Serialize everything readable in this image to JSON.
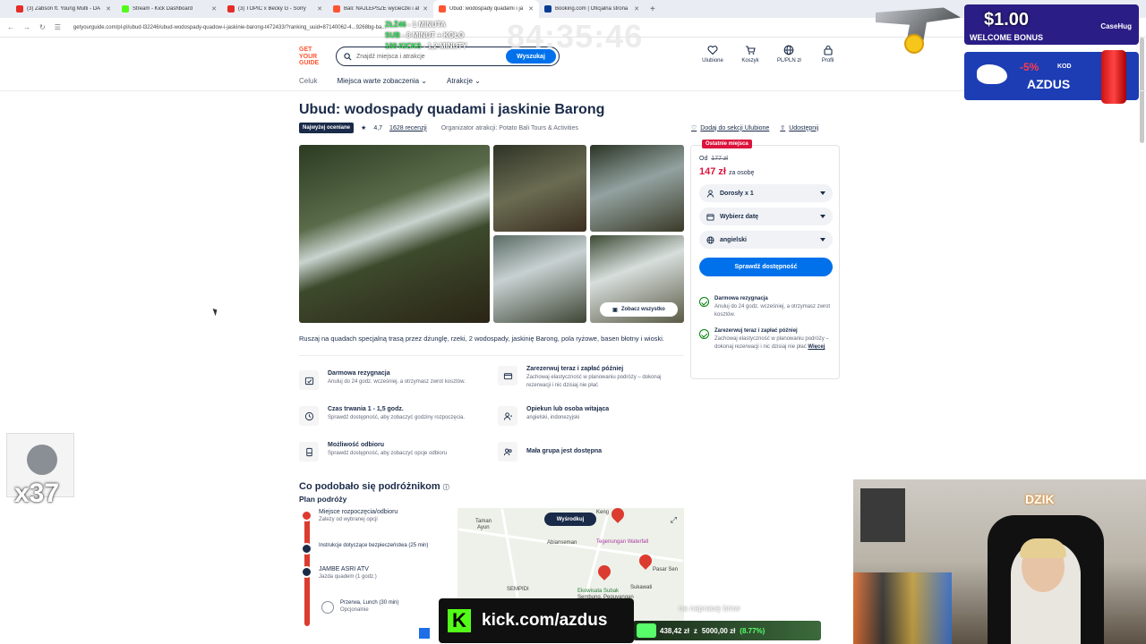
{
  "browser": {
    "tabs": [
      {
        "title": "(3) Zabson ft. Young Multi - DA",
        "color": "#e52d27"
      },
      {
        "title": "Stream - Kick Dashboard",
        "color": "#53fc18"
      },
      {
        "title": "(3) TOPIC x Becky G - Sorry",
        "color": "#e52d27"
      },
      {
        "title": "Bali: NAJLEPSZE wycieczki i atr",
        "color": "#ff5533"
      },
      {
        "title": "Ubud: wodospady quadami i ja",
        "color": "#ff5533"
      },
      {
        "title": "Booking.com | Oficjalna strona",
        "color": "#0a3c92"
      }
    ],
    "url": "getyourguide.com/pl-pl/ubud-l32246/ubud-wodospady-quadow-i-jaskinie-barong-t472433/?ranking_uuid=87140062-4...9268bg-ba..."
  },
  "header": {
    "logo": [
      "GET",
      "YOUR",
      "GUIDE"
    ],
    "search_placeholder": "Znajdź miejsca i atrakcje",
    "search_button": "Wyszukaj",
    "icons": [
      {
        "icon": "heart-icon",
        "label": "Ulubione"
      },
      {
        "icon": "cart-icon",
        "label": "Koszyk"
      },
      {
        "icon": "globe-icon",
        "label": "PL/PLN zł"
      },
      {
        "icon": "profile-icon",
        "label": "Profil"
      }
    ]
  },
  "subnav": [
    "Celuk",
    "Miejsca warte zobaczenia",
    "Atrakcje"
  ],
  "listing": {
    "title": "Ubud: wodospady quadami i jaskinie Barong",
    "badge": "Najwyżej oceniane",
    "rating": "4,7",
    "reviews": "1628 recenzji",
    "organizer": "Organizator atrakcji: Potato Bali Tours & Activities",
    "wishlist": "Dodaj do sekcji Ulubione",
    "share": "Udostępnij",
    "see_all": "Zobacz wszystko",
    "description": "Ruszaj na quadach specjalną trasą przez dżunglę, rzeki, 2 wodospady, jaskinię Barong, pola ryżowe, basen błotny i wioski."
  },
  "features": [
    {
      "icon": "calendar-check-icon",
      "title": "Darmowa rezygnacja",
      "sub": "Anuluj do 24 godz. wcześniej, a otrzymasz zwrot kosztów."
    },
    {
      "icon": "card-icon",
      "title": "Zarezerwuj teraz i zapłać później",
      "sub": "Zachowaj elastyczność w planowaniu podróży – dokonaj rezerwacji i nic dzisiaj nie płać"
    },
    {
      "icon": "clock-icon",
      "title": "Czas trwania 1 - 1,5 godz.",
      "sub": "Sprawdź dostępność, aby zobaczyć godziny rozpoczęcia."
    },
    {
      "icon": "guide-icon",
      "title": "Opiekun lub osoba witająca",
      "sub": "angielski, indonezyjski"
    },
    {
      "icon": "pickup-icon",
      "title": "Możliwość odbioru",
      "sub": "Sprawdź dostępność, aby zobaczyć opcje odbioru"
    },
    {
      "icon": "group-icon",
      "title": "Mała grupa jest dostępna",
      "sub": ""
    }
  ],
  "booking": {
    "last_spots": "Ostatnie miejsca",
    "from": "Od",
    "old_price": "177 zł",
    "price": "147 zł",
    "per": "za osobę",
    "selects": [
      {
        "icon": "person-icon",
        "label": "Dorosły x 1"
      },
      {
        "icon": "calendar-icon",
        "label": "Wybierz datę"
      },
      {
        "icon": "globe-icon",
        "label": "angielski"
      }
    ],
    "cta": "Sprawdź dostępność",
    "perks": [
      {
        "title": "Darmowa rezygnacja",
        "sub": "Anuluj do 24 godz. wcześniej, a otrzymasz zwrot kosztów."
      },
      {
        "title": "Zarezerwuj teraz i zapłać później",
        "sub": "Zachowaj elastyczność w planowaniu podróży – dokonaj rezerwacji i nic dzisiaj nie płać",
        "more": "Więcej"
      }
    ]
  },
  "itinerary": {
    "section_title": "Co podobało się podróżnikom",
    "plan_title": "Plan podróży",
    "stops": [
      {
        "title": "Miejsce rozpoczęcia/odbioru",
        "sub": "Zależy od wybranej opcji"
      },
      {
        "title": "Instrukcje dotyczące bezpieczeństwa (25 min)",
        "sub": ""
      },
      {
        "title": "JAMBE ASRI ATV",
        "sub": "Jazda quadem (1 godz.)"
      },
      {
        "title": "Przerwa, Lunch (30 min)",
        "sub": "Opcjonalnie"
      }
    ],
    "map": {
      "center_button": "Wyśrodkuj",
      "labels": [
        "Keng",
        "Taman",
        "Ayun",
        "Tegenungan Waterfall",
        "Abianseman",
        "Pasar Sen",
        "Sukawati",
        "Ekowisata Subak",
        "Sembung, Peguyangan",
        "SEMPIDI"
      ]
    }
  },
  "overlay": {
    "timer": "84:35:46",
    "goals": [
      {
        "accent": "ZŁŻ46",
        "text": " - 1 MINUTA"
      },
      {
        "accent": "SUB",
        "text": " - 8 MINUT + KOŁO"
      },
      {
        "accent": "100 KICKS",
        "text": " - 1,2 MINUTY"
      }
    ],
    "promo_amount": "$1.00",
    "promo_text": "WELCOME BONUS",
    "promo_brand": "CaseHug",
    "promo2_pct": "-5%",
    "promo2_kod": "KOD",
    "promo2_code": "AZDUS",
    "subs_count": "x37",
    "kick_url": "kick.com/azdus",
    "balance": "438,42 zł",
    "balance_target": "5000,00 zł",
    "balance_pct": "(8.77%)",
    "caption": "na naprawę bmw",
    "cam_brand": "DZIK"
  }
}
